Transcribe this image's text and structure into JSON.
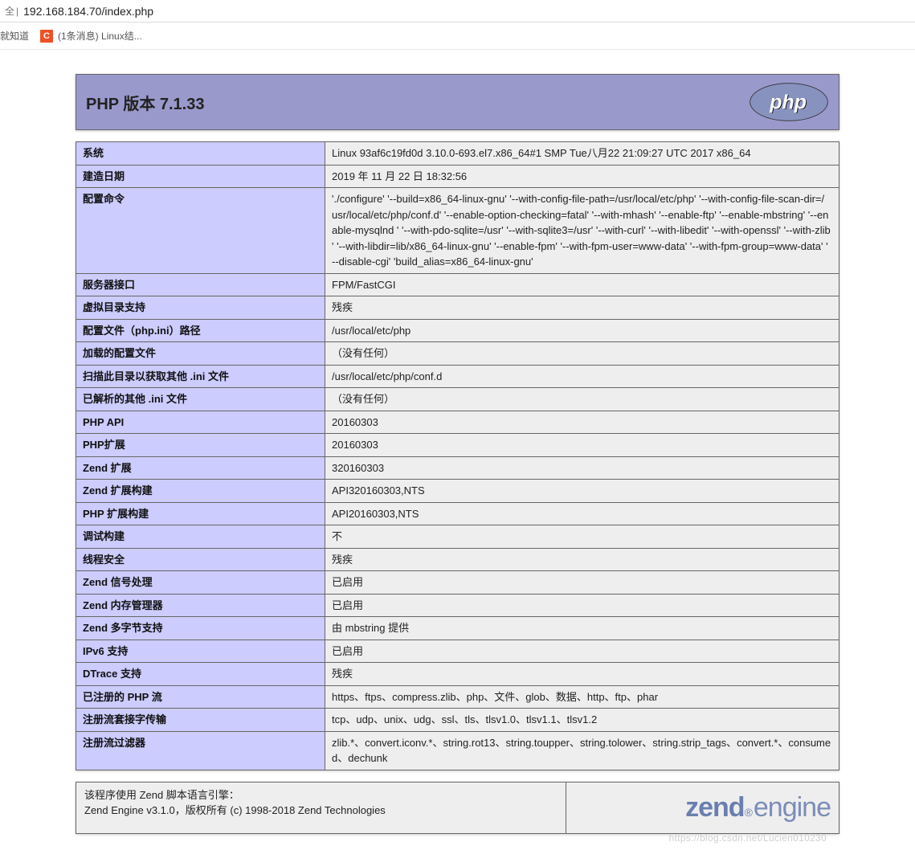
{
  "address_bar": {
    "security_label": "全",
    "url": "192.168.184.70/index.php"
  },
  "bookmarks": {
    "item1": "就知道",
    "item2_icon": "C",
    "item2_label": "(1条消息) Linux结..."
  },
  "header": {
    "title": "PHP 版本 7.1.33"
  },
  "rows": [
    {
      "label": "系统",
      "value": "Linux 93af6c19fd0d 3.10.0-693.el7.x86_64#1 SMP Tue八月22 21:09:27 UTC 2017 x86_64"
    },
    {
      "label": "建造日期",
      "value": "2019 年 11 月 22 日 18:32:56"
    },
    {
      "label": "配置命令",
      "value": "'./configure' '--build=x86_64-linux-gnu' '--with-config-file-path=/usr/local/etc/php' '--with-config-file-scan-dir=/ usr/local/etc/php/conf.d' '--enable-option-checking=fatal' '--with-mhash' '--enable-ftp' '--enable-mbstring' '--enable-mysqlnd ' '--with-pdo-sqlite=/usr' '--with-sqlite3=/usr' '--with-curl' '--with-libedit' '--with-openssl' '--with-zlib ' '--with-libdir=lib/x86_64-linux-gnu' '--enable-fpm' '--with-fpm-user=www-data' '--with-fpm-group=www-data' ' --disable-cgi' 'build_alias=x86_64-linux-gnu'"
    },
    {
      "label": "服务器接口",
      "value": "FPM/FastCGI"
    },
    {
      "label": "虚拟目录支持",
      "value": "残疾"
    },
    {
      "label": "配置文件（php.ini）路径",
      "value": "/usr/local/etc/php"
    },
    {
      "label": "加载的配置文件",
      "value": "（没有任何）"
    },
    {
      "label": "扫描此目录以获取其他 .ini 文件",
      "value": "/usr/local/etc/php/conf.d"
    },
    {
      "label": "已解析的其他 .ini 文件",
      "value": "（没有任何）"
    },
    {
      "label": "PHP API",
      "value": "20160303"
    },
    {
      "label": "PHP扩展",
      "value": "20160303"
    },
    {
      "label": "Zend 扩展",
      "value": "320160303"
    },
    {
      "label": "Zend 扩展构建",
      "value": "API320160303,NTS"
    },
    {
      "label": "PHP 扩展构建",
      "value": "API20160303,NTS"
    },
    {
      "label": "调试构建",
      "value": "不"
    },
    {
      "label": "线程安全",
      "value": "残疾"
    },
    {
      "label": "Zend 信号处理",
      "value": "已启用"
    },
    {
      "label": "Zend 内存管理器",
      "value": "已启用"
    },
    {
      "label": "Zend 多字节支持",
      "value": "由 mbstring 提供"
    },
    {
      "label": "IPv6 支持",
      "value": "已启用"
    },
    {
      "label": "DTrace 支持",
      "value": "残疾"
    },
    {
      "label": "已注册的 PHP 流",
      "value": "https、ftps、compress.zlib、php、文件、glob、数据、http、ftp、phar"
    },
    {
      "label": "注册流套接字传输",
      "value": "tcp、udp、unix、udg、ssl、tls、tlsv1.0、tlsv1.1、tlsv1.2"
    },
    {
      "label": "注册流过滤器",
      "value": "zlib.*、convert.iconv.*、string.rot13、string.toupper、string.tolower、string.strip_tags、convert.*、consumed、dechunk"
    }
  ],
  "footer": {
    "line1": "该程序使用 Zend 脚本语言引擎：",
    "line2": "Zend Engine v3.1.0，版权所有 (c) 1998-2018 Zend Technologies"
  },
  "watermark": "https://blog.csdn.net/Lucien010230"
}
